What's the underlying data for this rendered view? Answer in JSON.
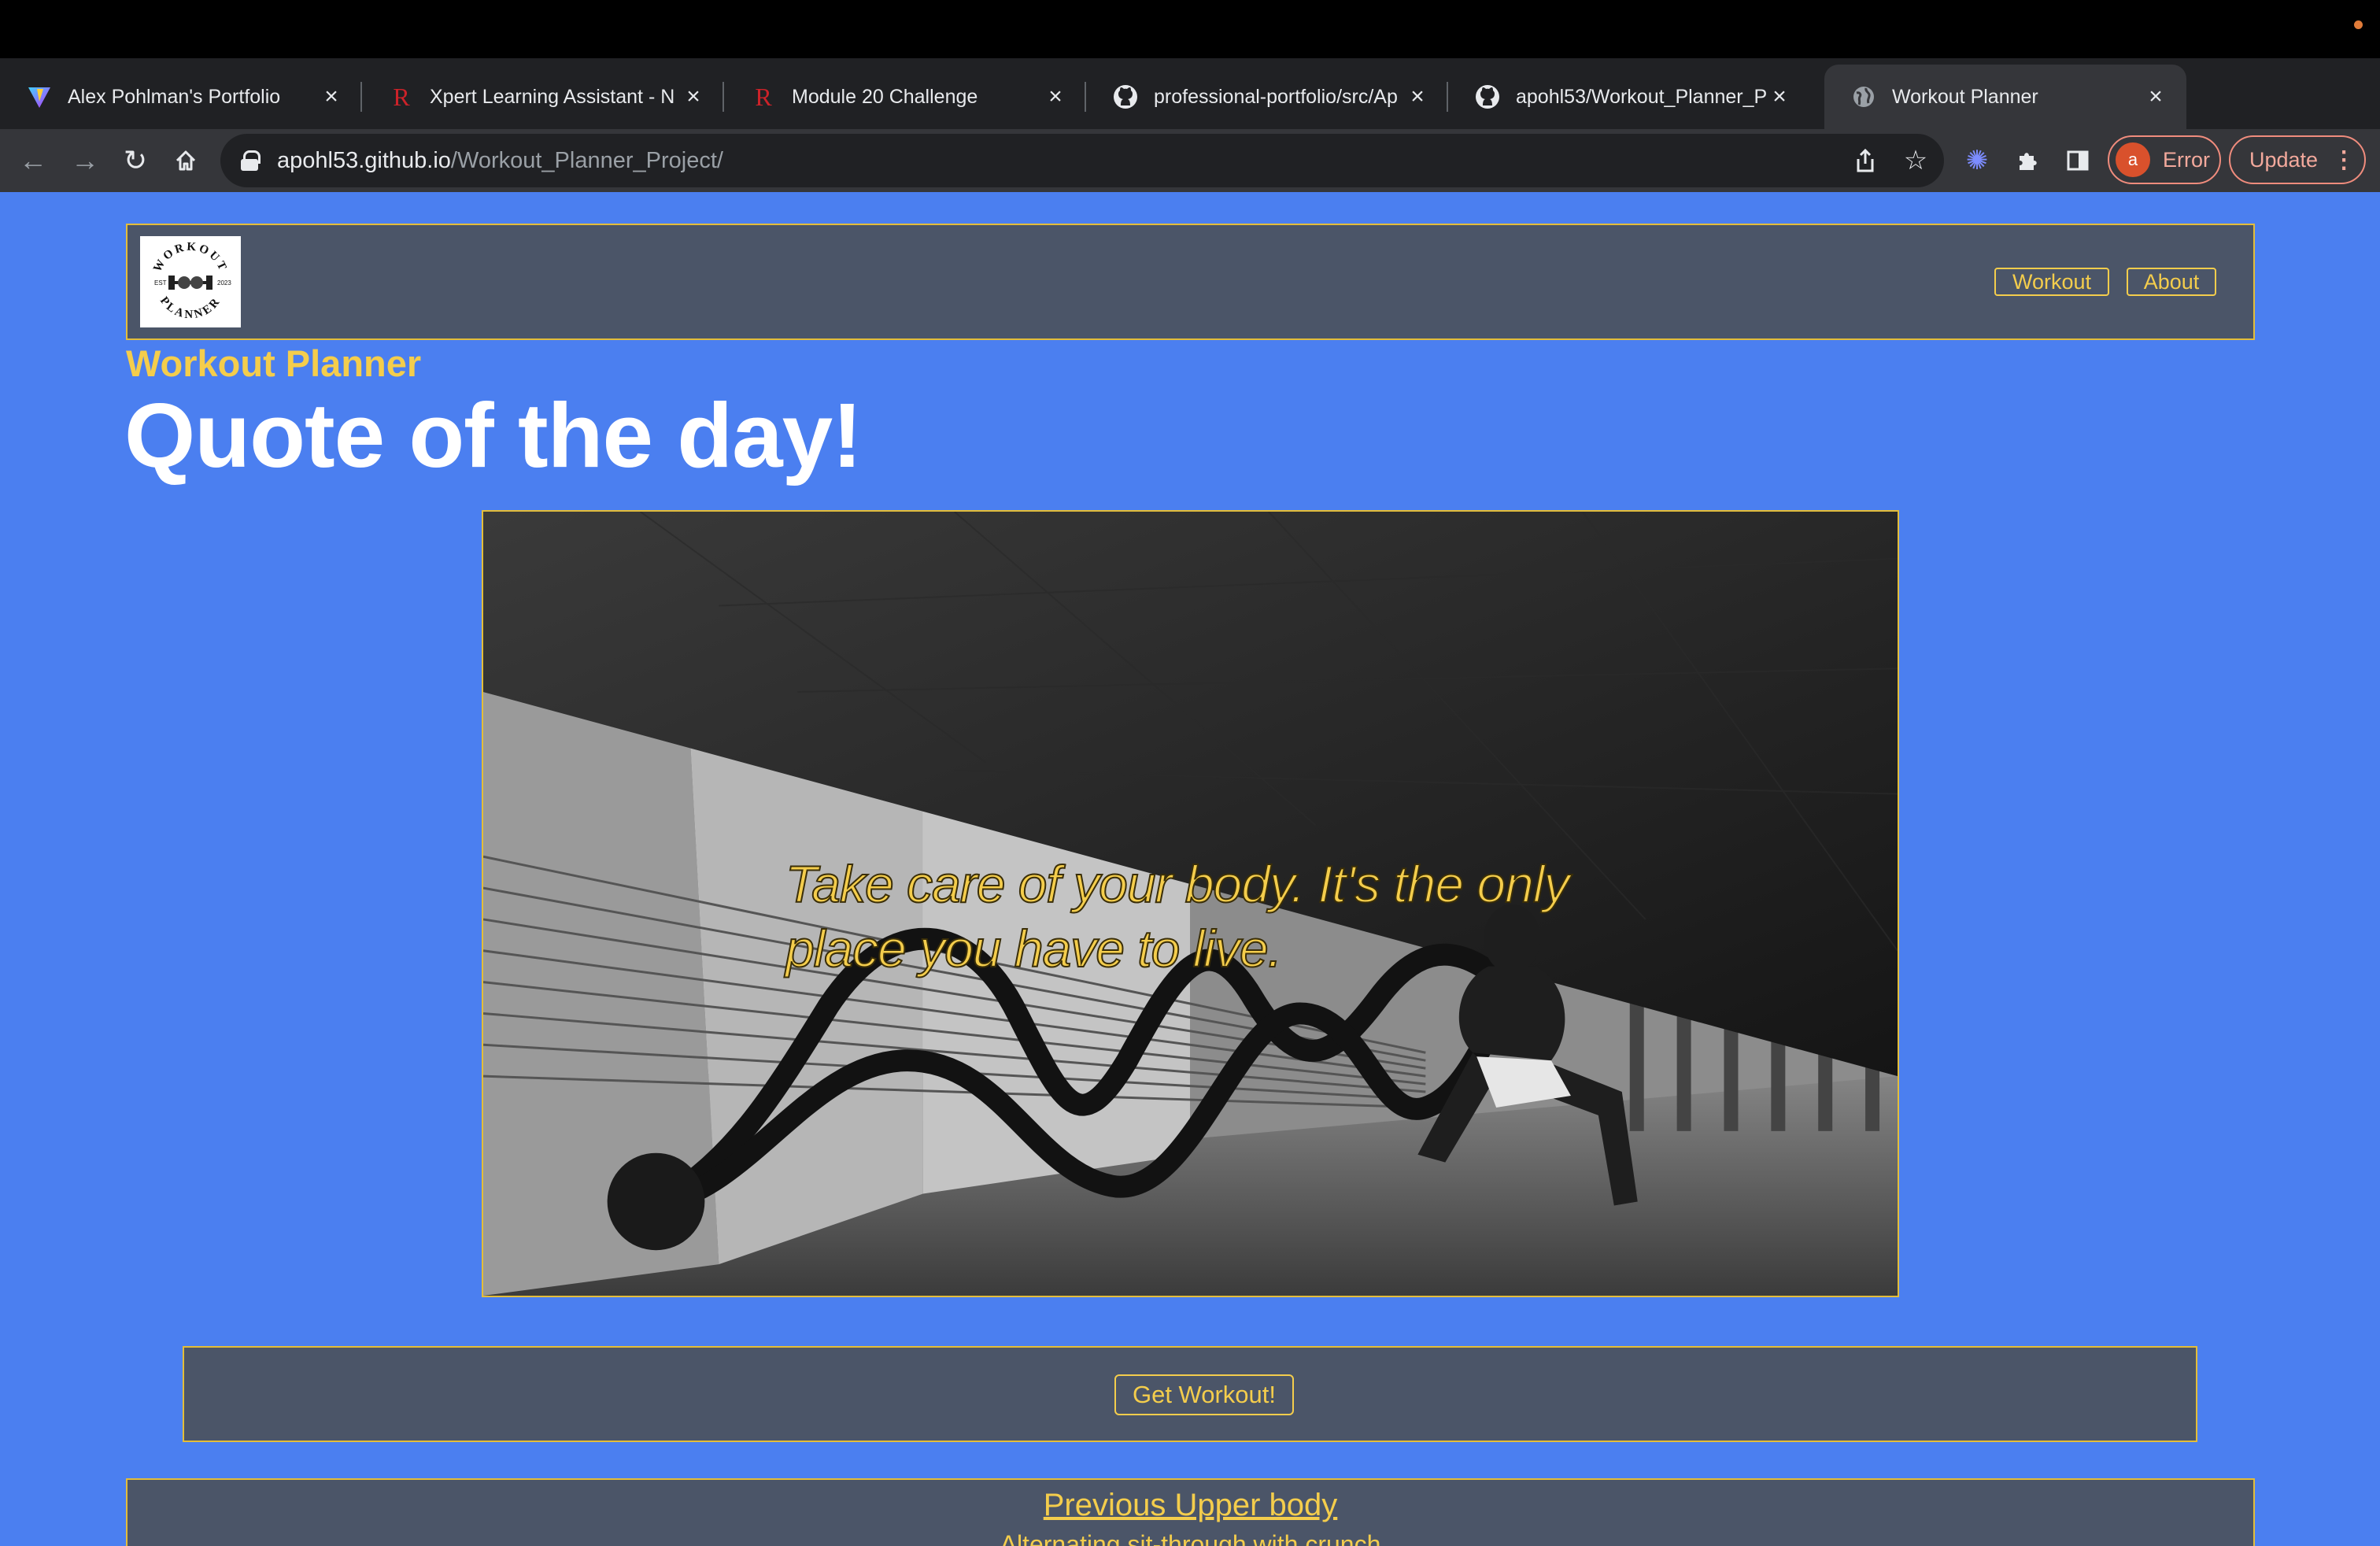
{
  "browser": {
    "tabs": [
      {
        "title": "Alex Pohlman's Portfolio",
        "favicon": "vite-logo-icon"
      },
      {
        "title": "Xpert Learning Assistant - N",
        "favicon": "rutgers-r-icon"
      },
      {
        "title": "Module 20 Challenge",
        "favicon": "rutgers-r-icon"
      },
      {
        "title": "professional-portfolio/src/Ap",
        "favicon": "github-icon"
      },
      {
        "title": "apohl53/Workout_Planner_P",
        "favicon": "github-icon"
      },
      {
        "title": "Workout Planner",
        "favicon": "globe-icon",
        "active": true
      }
    ],
    "address": {
      "host": "apohl53.github.io",
      "path": "/Workout_Planner_Project/"
    },
    "profile_initial": "a",
    "error_label": "Error",
    "update_label": "Update"
  },
  "site": {
    "logo": {
      "top_text": "WORKOUT",
      "bottom_text": "PLANNER",
      "left_text": "EST",
      "right_text": "2023"
    },
    "nav": [
      {
        "label": "Workout"
      },
      {
        "label": "About"
      }
    ],
    "brand": "Workout Planner",
    "hero_title": "Quote of the day!",
    "quote": "Take care of your body. It's the only place you have to live.",
    "cta_label": "Get Workout!",
    "previous": {
      "title": "Previous Upper body",
      "subtitle": "Alternating sit-through with crunch"
    }
  },
  "colors": {
    "page_bg": "#4b7ff0",
    "panel_bg": "#4b5568",
    "accent": "#f4cd4c"
  }
}
